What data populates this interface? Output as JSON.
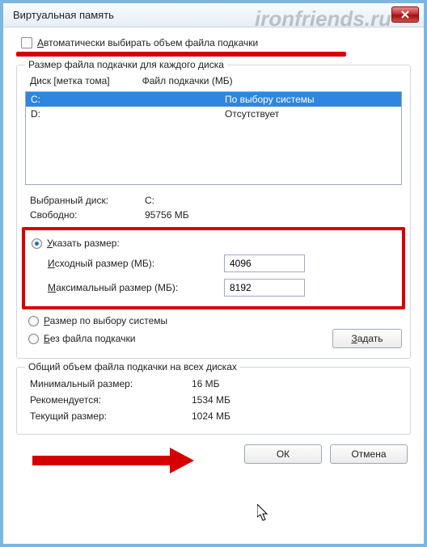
{
  "watermark": "ironfriends.ru",
  "title": "Виртуальная память",
  "auto_label_pre": "А",
  "auto_label_rest": "втоматически выбирать объем файла подкачки",
  "group1": {
    "title": "Размер файла подкачки для каждого диска",
    "col1_pre": "Д",
    "col1_rest": "иск [метка тома]",
    "col2": "Файл подкачки (МБ)",
    "rows": [
      {
        "drive": "C:",
        "pf": "По выбору системы",
        "selected": true
      },
      {
        "drive": "D:",
        "pf": "Отсутствует",
        "selected": false
      }
    ],
    "sel_label": "Выбранный диск:",
    "sel_value": "C:",
    "free_label": "Свободно:",
    "free_value": "95756 МБ",
    "custom_pre": "У",
    "custom_rest": "казать размер:",
    "init_pre": "И",
    "init_rest": "сходный размер (МБ):",
    "init_val": "4096",
    "max_pre": "М",
    "max_rest": "аксимальный размер (МБ):",
    "max_val": "8192",
    "sys_pre": "Р",
    "sys_rest": "азмер по выбору системы",
    "none_pre": "Б",
    "none_rest": "ез файла подкачки",
    "set_pre": "З",
    "set_rest": "адать"
  },
  "group2": {
    "title": "Общий объем файла подкачки на всех дисках",
    "min_l": "Минимальный размер:",
    "min_v": "16 МБ",
    "rec_l": "Рекомендуется:",
    "rec_v": "1534 МБ",
    "cur_l": "Текущий размер:",
    "cur_v": "1024 МБ"
  },
  "ok": "ОК",
  "cancel": "Отмена"
}
